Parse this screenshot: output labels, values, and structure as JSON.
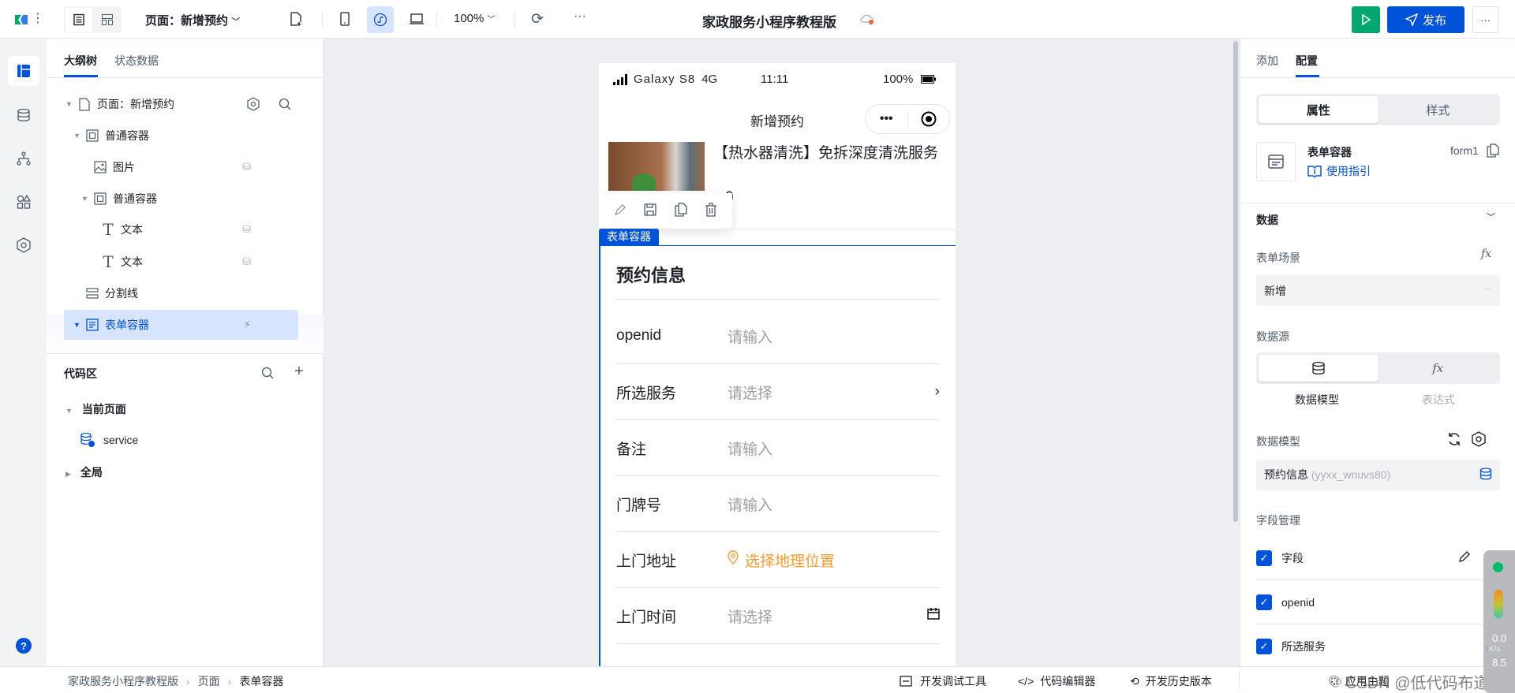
{
  "topbar": {
    "page_selector": "页面：新增预约",
    "zoom": "100%",
    "app_title": "家政服务小程序教程版",
    "publish_label": "发布",
    "more_label": "···",
    "run_color": "#00a870",
    "publish_color": "#0052d9"
  },
  "left_panel": {
    "tabs": [
      {
        "label": "大纲树",
        "active": true
      },
      {
        "label": "状态数据",
        "active": false
      }
    ],
    "tree": [
      {
        "label": "页面：新增预约",
        "icon": "page-icon"
      },
      {
        "label": "普通容器",
        "icon": "container-icon"
      },
      {
        "label": "图片",
        "icon": "image-icon"
      },
      {
        "label": "普通容器",
        "icon": "container-icon"
      },
      {
        "label": "文本",
        "icon": "text-icon"
      },
      {
        "label": "文本",
        "icon": "text-icon"
      },
      {
        "label": "分割线",
        "icon": "divider-icon"
      },
      {
        "label": "表单容器",
        "icon": "form-icon",
        "selected": true
      }
    ],
    "code_area": {
      "title": "代码区",
      "groups": [
        {
          "label": "当前页面"
        },
        {
          "label": "全局"
        }
      ],
      "items": [
        {
          "label": "service"
        }
      ]
    }
  },
  "phone": {
    "device": "Galaxy S8",
    "network": "4G",
    "time": "11:11",
    "battery": "100%",
    "nav_title": "新增预约",
    "product_title": "【热水器清洗】免拆深度清洗服务",
    "price_fragment": "0",
    "selected_tag": "表单容器",
    "form_title": "预约信息",
    "fields": [
      {
        "label": "openid",
        "placeholder": "请输入"
      },
      {
        "label": "所选服务",
        "placeholder": "请选择",
        "suffix": "›"
      },
      {
        "label": "备注",
        "placeholder": "请输入"
      },
      {
        "label": "门牌号",
        "placeholder": "请输入"
      },
      {
        "label": "上门地址",
        "placeholder": "选择地理位置",
        "accent": "#ff9a2e"
      },
      {
        "label": "上门时间",
        "placeholder": "请选择"
      }
    ]
  },
  "right_panel": {
    "tabs": [
      {
        "label": "添加",
        "active": false
      },
      {
        "label": "配置",
        "active": true
      }
    ],
    "segment": [
      "属性",
      "样式"
    ],
    "component": {
      "name": "表单容器",
      "guide": "使用指引",
      "id": "form1"
    },
    "section_title": "数据",
    "form_scene": {
      "label": "表单场景",
      "value": "新增"
    },
    "datasource": {
      "label": "数据源",
      "options": [
        "数据模型",
        "表达式"
      ]
    },
    "data_model": {
      "label": "数据模型",
      "value": "预约信息",
      "code": "(yyxx_wnuvs80)"
    },
    "field_mgmt": {
      "label": "字段管理",
      "items": [
        {
          "label": "字段",
          "checked": true
        },
        {
          "label": "openid",
          "checked": true
        },
        {
          "label": "所选服务",
          "checked": true
        }
      ]
    }
  },
  "bottombar": {
    "breadcrumb": [
      "家政服务小程序教程版",
      "页面",
      "表单容器"
    ],
    "tools": [
      "开发调试工具",
      "代码编辑器",
      "开发历史版本"
    ],
    "theme": "应用主题",
    "watermark": "CSDN @低代码布道师"
  },
  "monitor": {
    "upload": "0.0",
    "download": "8.5",
    "unit": "K/s"
  }
}
